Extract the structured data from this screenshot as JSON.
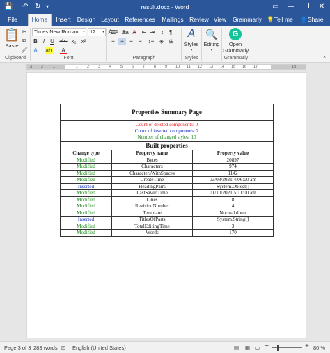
{
  "window": {
    "title": "result.docx - Word",
    "minimize_glyph": "—",
    "restore_glyph": "❐",
    "close_glyph": "✕"
  },
  "quick_access": {
    "save_glyph": "💾",
    "undo_glyph": "↶",
    "redo_glyph": "↻",
    "more_glyph": "▾"
  },
  "tabs": [
    "File",
    "Home",
    "Insert",
    "Design",
    "Layout",
    "References",
    "Mailings",
    "Review",
    "View",
    "Grammarly"
  ],
  "tell_me": "Tell me",
  "share": "Share",
  "ribbon": {
    "clipboard": {
      "paste_label": "Paste",
      "group_label": "Clipboard"
    },
    "font": {
      "font_name": "Times New Roman",
      "font_size": "12",
      "grow": "A",
      "shrink": "A",
      "aa": "Aa",
      "clear": "A",
      "bold": "B",
      "italic": "I",
      "underline": "U",
      "strike": "abc",
      "subscript": "x₂",
      "superscript": "x²",
      "text_effects": "A",
      "highlight": "ab",
      "font_color": "A",
      "group_label": "Font"
    },
    "paragraph": {
      "group_label": "Paragraph"
    },
    "styles": {
      "styles_label": "Styles",
      "group_label": "Styles"
    },
    "editing": {
      "editing_label": "Editing"
    },
    "grammarly": {
      "open_label_1": "Open",
      "open_label_2": "Grammarly",
      "group_label": "Grammarly"
    }
  },
  "ruler": {
    "ticks": [
      "3",
      "2",
      "1",
      "1",
      "2",
      "3",
      "4",
      "5",
      "6",
      "7",
      "8",
      "9",
      "10",
      "11",
      "12",
      "13",
      "14",
      "15",
      "16",
      "17",
      "18"
    ]
  },
  "document": {
    "summary_title": "Properties Summary Page",
    "deleted": "Count of deleted components: 0",
    "inserted": "Count of inserted components: 2",
    "changed_styles": "Number of changed styles: 10",
    "built_title": "Built properties",
    "headers": [
      "Change type",
      "Property name",
      "Property value"
    ],
    "rows": [
      {
        "type": "Modified",
        "name": "Bytes",
        "value": "20897"
      },
      {
        "type": "Modified",
        "name": "Characters",
        "value": "974"
      },
      {
        "type": "Modified",
        "name": "CharactersWithSpaces",
        "value": "1142"
      },
      {
        "type": "Modified",
        "name": "CreateTime",
        "value": "03/08/2021 4:06:00 am"
      },
      {
        "type": "Inserted",
        "name": "HeadingPairs",
        "value": "System.Object[]"
      },
      {
        "type": "Modified",
        "name": "LastSavedTime",
        "value": "01/10/2021 5:11:00 am"
      },
      {
        "type": "Modified",
        "name": "Lines",
        "value": "8"
      },
      {
        "type": "Modified",
        "name": "RevisionNumber",
        "value": "4"
      },
      {
        "type": "Modified",
        "name": "Template",
        "value": "Normal.dotm"
      },
      {
        "type": "Inserted",
        "name": "TitlesOfParts",
        "value": "System.String[]"
      },
      {
        "type": "Modified",
        "name": "TotalEditingTime",
        "value": "3"
      },
      {
        "type": "Modified",
        "name": "Words",
        "value": "170"
      }
    ]
  },
  "status": {
    "page": "Page 3 of 3",
    "words": "283 words",
    "language": "English (United States)",
    "zoom_minus": "−",
    "zoom_plus": "+",
    "zoom": "80 %"
  },
  "colors": {
    "accent": "#2b579a",
    "deleted": "#e31b1b",
    "inserted": "#1a2dbf",
    "changed": "#1a8a1a"
  }
}
